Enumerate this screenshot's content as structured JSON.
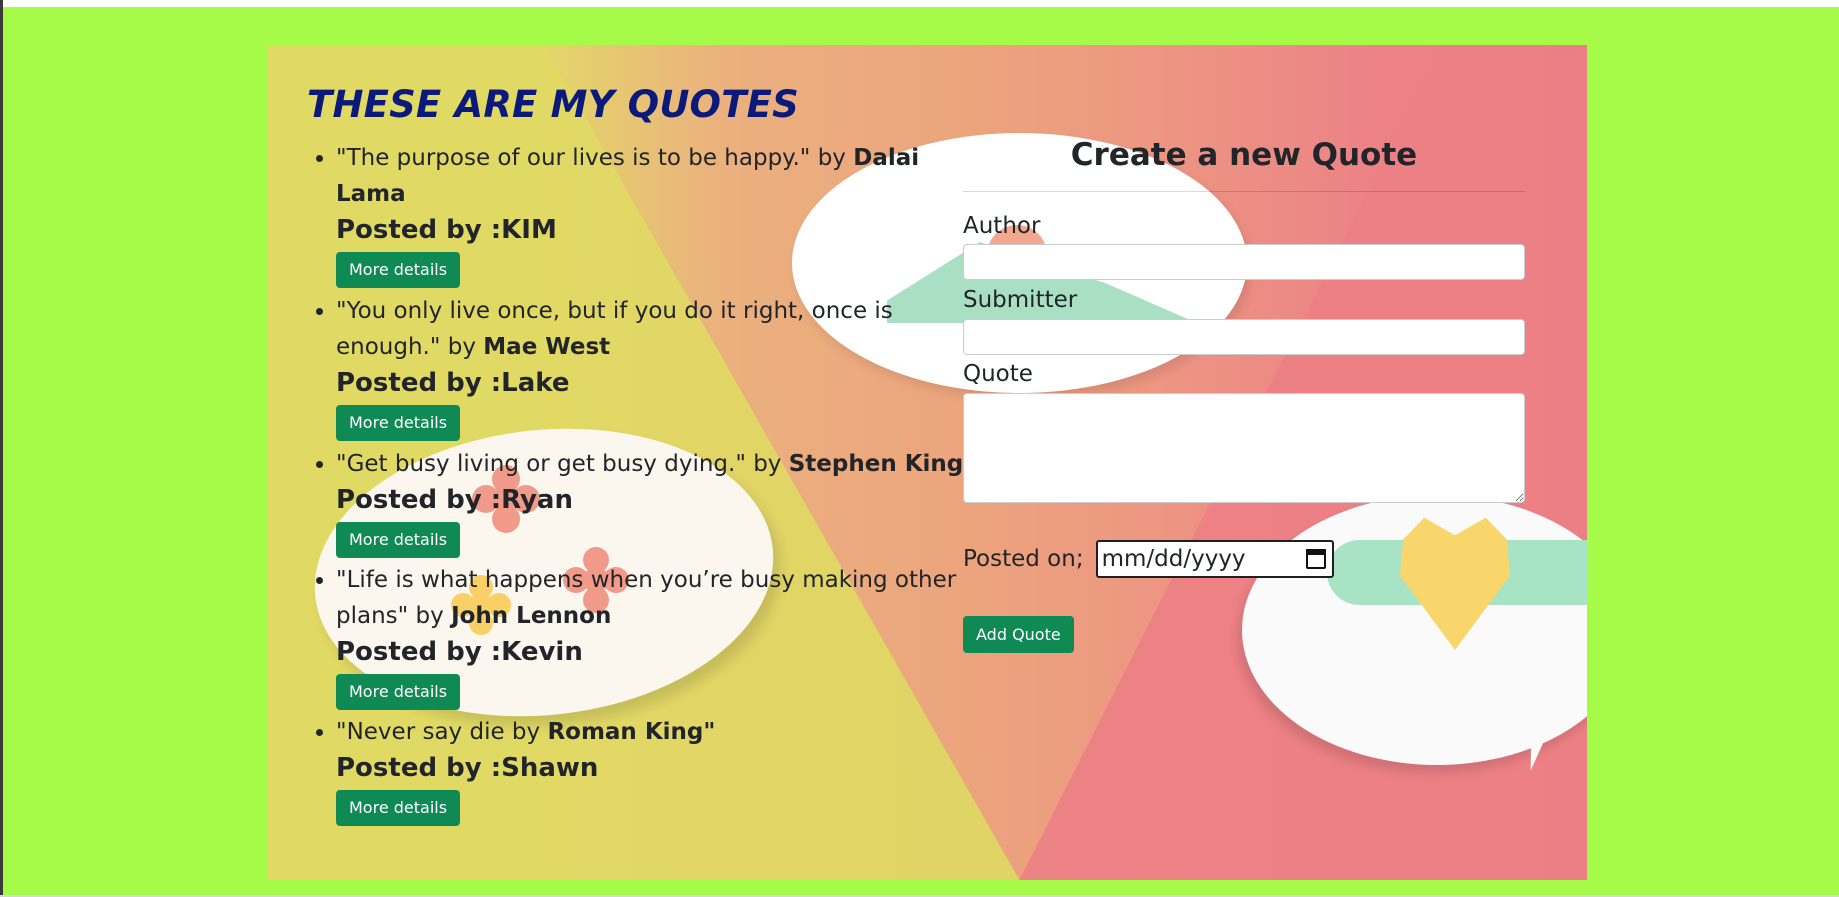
{
  "page": {
    "background_color": "#a5fb48",
    "title_color": "#0b1a7a",
    "button_color": "#108a54"
  },
  "header": {
    "title": "THESE ARE MY QUOTES"
  },
  "quotes": [
    {
      "text": "\"The purpose of our lives is to be happy.\" by ",
      "author": "Dalai Lama",
      "posted_by": "Posted by :KIM",
      "button_label": "More details"
    },
    {
      "text": "\"You only live once, but if you do it right, once is enough.\" by ",
      "author": "Mae West",
      "posted_by": "Posted by :Lake",
      "button_label": "More details"
    },
    {
      "text": "\"Get busy living or get busy dying.\" by ",
      "author": "Stephen King",
      "posted_by": "Posted by :Ryan",
      "button_label": "More details"
    },
    {
      "text": "\"Life is what happens when you’re busy making other plans\" by ",
      "author": "John Lennon",
      "posted_by": "Posted by :Kevin",
      "button_label": "More details"
    },
    {
      "text": "\"Never say die by ",
      "author": "Roman King\"",
      "posted_by": "Posted by :Shawn",
      "button_label": "More details"
    }
  ],
  "form": {
    "title": "Create a new Quote",
    "author_label": "Author",
    "author_value": "",
    "submitter_label": "Submitter",
    "submitter_value": "",
    "quote_label": "Quote",
    "quote_value": "",
    "posted_on_label": "Posted on;",
    "date_placeholder": "mm/dd/yyyy",
    "submit_label": "Add Quote"
  },
  "icons": {
    "date_picker": "calendar-icon"
  }
}
